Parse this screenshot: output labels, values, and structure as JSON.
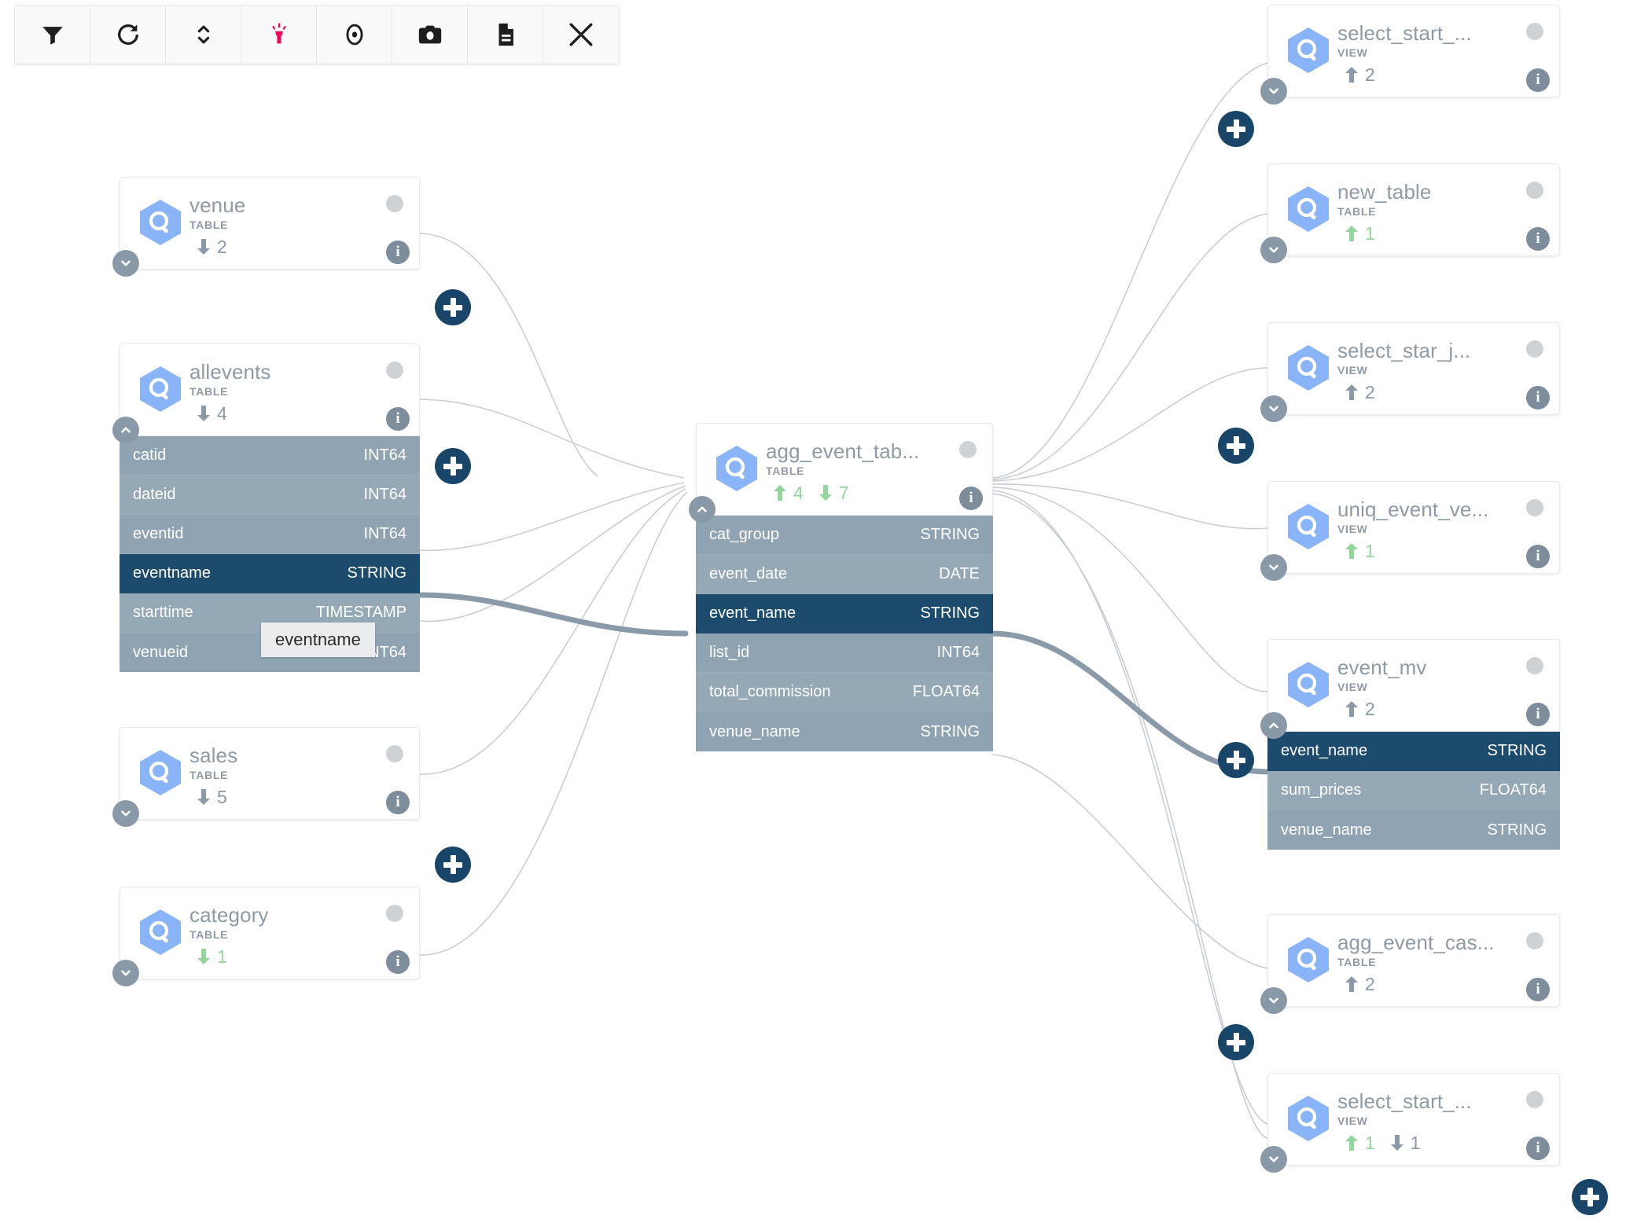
{
  "toolbar": {
    "buttons": [
      {
        "name": "filter-icon",
        "label": "Filter"
      },
      {
        "name": "refresh-icon",
        "label": "Refresh"
      },
      {
        "name": "expand-collapse-icon",
        "label": "Expand/Collapse"
      },
      {
        "name": "highlighter-icon",
        "label": "Highlight"
      },
      {
        "name": "focus-icon",
        "label": "Focus"
      },
      {
        "name": "camera-icon",
        "label": "Screenshot"
      },
      {
        "name": "document-icon",
        "label": "Details"
      },
      {
        "name": "collapse-fullscreen-icon",
        "label": "Exit fullscreen"
      }
    ],
    "highlight_color": "#f50057"
  },
  "colors": {
    "accent_plus": "#194569",
    "field_row": "#8fa3b2",
    "field_row_highlight": "#1c4b6e",
    "count_green": "#93d69b",
    "count_slate": "#8a99a8",
    "node_icon_blue": "#8ab4f8",
    "edge_highlight": "#8a9aa9"
  },
  "tooltip": {
    "text": "eventname"
  },
  "nodes": [
    {
      "id": "venue",
      "name": "venue",
      "type": "TABLE",
      "counts": [
        {
          "dir": "down",
          "value": "2",
          "color": "slate"
        }
      ],
      "expanded": false,
      "fields": []
    },
    {
      "id": "allevents",
      "name": "allevents",
      "type": "TABLE",
      "counts": [
        {
          "dir": "down",
          "value": "4",
          "color": "slate"
        }
      ],
      "expanded": true,
      "fields": [
        {
          "name": "catid",
          "type": "INT64",
          "highlighted": false
        },
        {
          "name": "dateid",
          "type": "INT64",
          "highlighted": false
        },
        {
          "name": "eventid",
          "type": "INT64",
          "highlighted": false
        },
        {
          "name": "eventname",
          "type": "STRING",
          "highlighted": true
        },
        {
          "name": "starttime",
          "type": "TIMESTAMP",
          "highlighted": false
        },
        {
          "name": "venueid",
          "type": "INT64",
          "highlighted": false
        }
      ]
    },
    {
      "id": "sales",
      "name": "sales",
      "type": "TABLE",
      "counts": [
        {
          "dir": "down",
          "value": "5",
          "color": "slate"
        }
      ],
      "expanded": false,
      "fields": []
    },
    {
      "id": "category",
      "name": "category",
      "type": "TABLE",
      "counts": [
        {
          "dir": "down",
          "value": "1",
          "color": "green"
        }
      ],
      "expanded": false,
      "fields": []
    },
    {
      "id": "agg_event_table",
      "name": "agg_event_tab...",
      "type": "TABLE",
      "counts": [
        {
          "dir": "up",
          "value": "4",
          "color": "green"
        },
        {
          "dir": "down",
          "value": "7",
          "color": "green"
        }
      ],
      "expanded": true,
      "fields": [
        {
          "name": "cat_group",
          "type": "STRING",
          "highlighted": false
        },
        {
          "name": "event_date",
          "type": "DATE",
          "highlighted": false
        },
        {
          "name": "event_name",
          "type": "STRING",
          "highlighted": true
        },
        {
          "name": "list_id",
          "type": "INT64",
          "highlighted": false
        },
        {
          "name": "total_commission",
          "type": "FLOAT64",
          "highlighted": false
        },
        {
          "name": "venue_name",
          "type": "STRING",
          "highlighted": false
        }
      ]
    },
    {
      "id": "select_start_top",
      "name": "select_start_...",
      "type": "VIEW",
      "counts": [
        {
          "dir": "up",
          "value": "2",
          "color": "slate"
        }
      ],
      "expanded": false,
      "fields": []
    },
    {
      "id": "new_table",
      "name": "new_table",
      "type": "TABLE",
      "counts": [
        {
          "dir": "up",
          "value": "1",
          "color": "green"
        }
      ],
      "expanded": false,
      "fields": []
    },
    {
      "id": "select_star_j",
      "name": "select_star_j...",
      "type": "VIEW",
      "counts": [
        {
          "dir": "up",
          "value": "2",
          "color": "slate"
        }
      ],
      "expanded": false,
      "fields": []
    },
    {
      "id": "uniq_event_ve",
      "name": "uniq_event_ve...",
      "type": "VIEW",
      "counts": [
        {
          "dir": "up",
          "value": "1",
          "color": "green"
        }
      ],
      "expanded": false,
      "fields": []
    },
    {
      "id": "event_mv",
      "name": "event_mv",
      "type": "VIEW",
      "counts": [
        {
          "dir": "up",
          "value": "2",
          "color": "slate"
        }
      ],
      "expanded": true,
      "fields": [
        {
          "name": "event_name",
          "type": "STRING",
          "highlighted": true
        },
        {
          "name": "sum_prices",
          "type": "FLOAT64",
          "highlighted": false
        },
        {
          "name": "venue_name",
          "type": "STRING",
          "highlighted": false
        }
      ]
    },
    {
      "id": "agg_event_cas",
      "name": "agg_event_cas...",
      "type": "TABLE",
      "counts": [
        {
          "dir": "up",
          "value": "2",
          "color": "slate"
        }
      ],
      "expanded": false,
      "fields": []
    },
    {
      "id": "select_start_bottom",
      "name": "select_start_...",
      "type": "VIEW",
      "counts": [
        {
          "dir": "up",
          "value": "1",
          "color": "green"
        },
        {
          "dir": "down",
          "value": "1",
          "color": "slate"
        }
      ],
      "expanded": false,
      "fields": []
    }
  ],
  "expand_buttons": [
    {
      "name": "expand-upstream-venue"
    },
    {
      "name": "expand-upstream-allevents"
    },
    {
      "name": "expand-upstream-sales"
    },
    {
      "name": "expand-downstream-select-start-top"
    },
    {
      "name": "expand-downstream-select-star-j"
    },
    {
      "name": "expand-downstream-event-mv"
    },
    {
      "name": "expand-downstream-agg-event-cas"
    },
    {
      "name": "add-node-button"
    }
  ]
}
